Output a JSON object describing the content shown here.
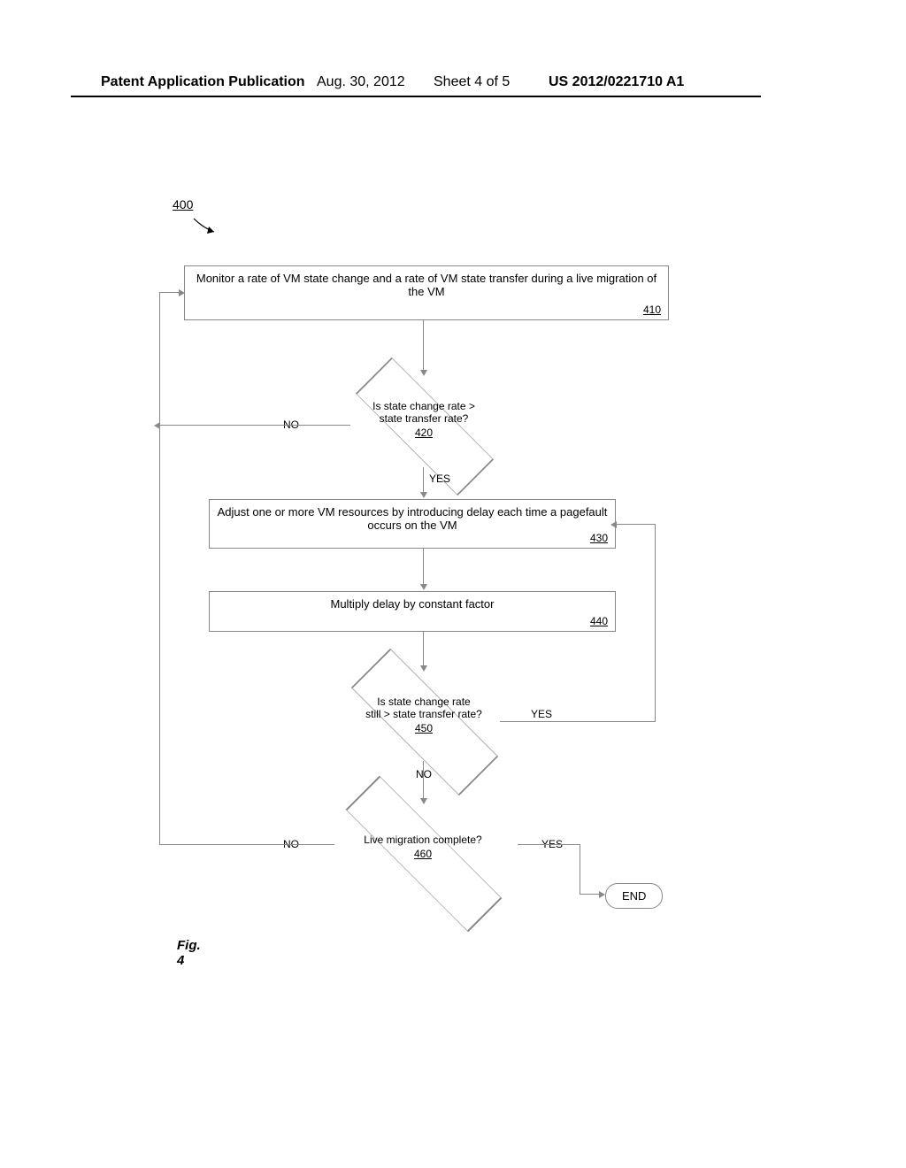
{
  "header": {
    "left": "Patent Application Publication",
    "date": "Aug. 30, 2012",
    "sheet": "Sheet 4 of 5",
    "right": "US 2012/0221710 A1"
  },
  "ref400": "400",
  "box410": {
    "text": "Monitor a rate of VM state change and a rate of VM state transfer during a live migration of the VM",
    "ref": "410"
  },
  "diamond420": {
    "text1": "Is state change rate >",
    "text2": "state transfer rate?",
    "ref": "420",
    "no": "NO",
    "yes": "YES"
  },
  "box430": {
    "text": "Adjust one or more VM resources by introducing delay each time a pagefault occurs on the VM",
    "ref": "430"
  },
  "box440": {
    "text": "Multiply delay by constant factor",
    "ref": "440"
  },
  "diamond450": {
    "text1": "Is state change rate",
    "text2": "still > state transfer rate?",
    "ref": "450",
    "no": "NO",
    "yes": "YES"
  },
  "diamond460": {
    "text": "Live migration complete?",
    "ref": "460",
    "no": "NO",
    "yes": "YES"
  },
  "end": "END",
  "figLabel": "Fig. 4"
}
